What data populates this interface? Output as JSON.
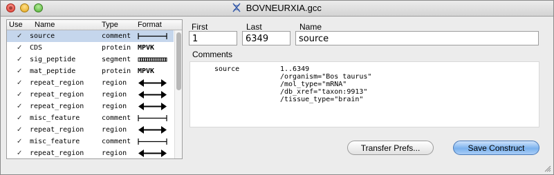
{
  "window": {
    "title": "BOVNEURXIA.gcc"
  },
  "table": {
    "columns": [
      "Use",
      "Name",
      "Type",
      "Format"
    ],
    "rows": [
      {
        "check": "✓",
        "name": "source",
        "type": "comment",
        "format": "bar"
      },
      {
        "check": "✓",
        "name": "CDS",
        "type": "protein",
        "format": "MPVK"
      },
      {
        "check": "✓",
        "name": "sig_peptide",
        "type": "segment",
        "format": "segmented"
      },
      {
        "check": "✓",
        "name": "mat_peptide",
        "type": "protein",
        "format": "MPVK"
      },
      {
        "check": "✓",
        "name": "repeat_region",
        "type": "region",
        "format": "double-arrow"
      },
      {
        "check": "✓",
        "name": "repeat_region",
        "type": "region",
        "format": "double-arrow"
      },
      {
        "check": "✓",
        "name": "repeat_region",
        "type": "region",
        "format": "double-arrow"
      },
      {
        "check": "✓",
        "name": "misc_feature",
        "type": "comment",
        "format": "bar"
      },
      {
        "check": "✓",
        "name": "repeat_region",
        "type": "region",
        "format": "double-arrow"
      },
      {
        "check": "✓",
        "name": "misc_feature",
        "type": "comment",
        "format": "bar"
      },
      {
        "check": "✓",
        "name": "repeat_region",
        "type": "region",
        "format": "double-arrow"
      }
    ],
    "selected_index": 0
  },
  "fields": {
    "first_label": "First",
    "first_value": "1",
    "last_label": "Last",
    "last_value": "6349",
    "name_label": "Name",
    "name_value": "source"
  },
  "comments": {
    "label": "Comments",
    "key": "source",
    "lines": [
      "1..6349",
      "/organism=\"Bos taurus\"",
      "/mol_type=\"mRNA\"",
      "/db_xref=\"taxon:9913\"",
      "/tissue_type=\"brain\""
    ]
  },
  "buttons": {
    "transfer_label": "Transfer Prefs...",
    "save_label": "Save Construct"
  },
  "colors": {
    "selection": "#c5d6ec",
    "default_button": "#7bb2ee"
  }
}
